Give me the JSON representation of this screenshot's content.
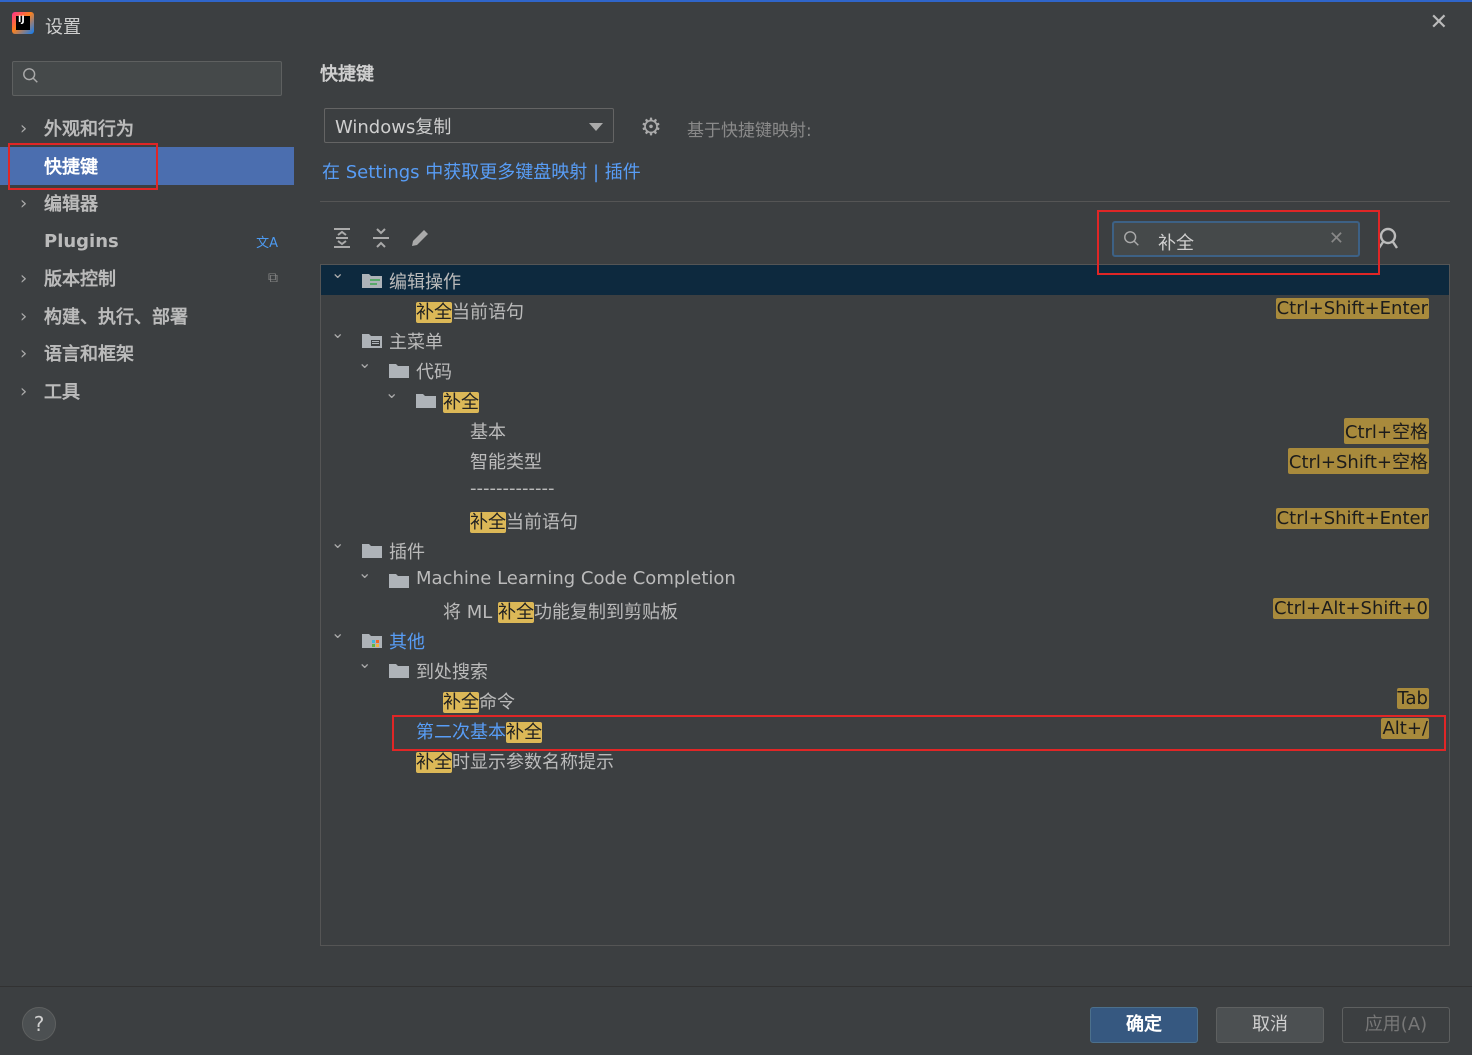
{
  "window": {
    "title": "设置"
  },
  "sidebar": {
    "search_placeholder": "",
    "items": [
      {
        "label": "外观和行为",
        "expandable": true
      },
      {
        "label": "快捷键",
        "expandable": false,
        "selected": true
      },
      {
        "label": "编辑器",
        "expandable": true
      },
      {
        "label": "Plugins",
        "expandable": false,
        "right_icon": "translate-icon"
      },
      {
        "label": "版本控制",
        "expandable": true,
        "right_icon": "copy-icon"
      },
      {
        "label": "构建、执行、部署",
        "expandable": true
      },
      {
        "label": "语言和框架",
        "expandable": true
      },
      {
        "label": "工具",
        "expandable": true
      }
    ]
  },
  "main": {
    "title": "快捷键",
    "keymap_value": "Windows复制",
    "based_on_label": "基于快捷键映射:",
    "settings_link": "在 Settings 中获取更多键盘映射 | 插件",
    "search_value": "补全",
    "tree": [
      {
        "id": "r0",
        "level": 0,
        "expanded": true,
        "icon": "editor-actions-icon",
        "parts": [
          {
            "t": "编辑操作"
          }
        ],
        "selected": true
      },
      {
        "id": "r1",
        "level": 1,
        "parts": [
          {
            "t": "补全",
            "hl": true
          },
          {
            "t": "当前语句"
          }
        ],
        "shortcut": "Ctrl+Shift+Enter"
      },
      {
        "id": "r2",
        "level": 0,
        "expanded": true,
        "icon": "main-menu-icon",
        "parts": [
          {
            "t": "主菜单"
          }
        ]
      },
      {
        "id": "r3",
        "level": 1,
        "expanded": true,
        "icon": "folder-icon",
        "parts": [
          {
            "t": "代码"
          }
        ]
      },
      {
        "id": "r4",
        "level": 2,
        "expanded": true,
        "icon": "folder-icon",
        "parts": [
          {
            "t": "补全",
            "hl": true
          }
        ]
      },
      {
        "id": "r5",
        "level": 3,
        "parts": [
          {
            "t": "基本"
          }
        ],
        "shortcut": "Ctrl+空格"
      },
      {
        "id": "r6",
        "level": 3,
        "parts": [
          {
            "t": "智能类型"
          }
        ],
        "shortcut": "Ctrl+Shift+空格"
      },
      {
        "id": "r7",
        "level": 3,
        "parts": [
          {
            "t": "-------------"
          }
        ]
      },
      {
        "id": "r8",
        "level": 3,
        "parts": [
          {
            "t": "补全",
            "hl": true
          },
          {
            "t": "当前语句"
          }
        ],
        "shortcut": "Ctrl+Shift+Enter"
      },
      {
        "id": "r9",
        "level": 0,
        "expanded": true,
        "icon": "folder-icon",
        "parts": [
          {
            "t": "插件"
          }
        ]
      },
      {
        "id": "r10",
        "level": 1,
        "expanded": true,
        "icon": "folder-icon",
        "parts": [
          {
            "t": "Machine Learning Code Completion"
          }
        ]
      },
      {
        "id": "r11",
        "level": 2,
        "parts": [
          {
            "t": "将 ML "
          },
          {
            "t": "补全",
            "hl": true
          },
          {
            "t": "功能复制到剪贴板"
          }
        ],
        "shortcut": "Ctrl+Alt+Shift+0"
      },
      {
        "id": "r12",
        "level": 0,
        "expanded": true,
        "icon": "other-icon",
        "parts": [
          {
            "t": "其他",
            "blue": true
          }
        ]
      },
      {
        "id": "r13",
        "level": 1,
        "expanded": true,
        "icon": "folder-icon",
        "parts": [
          {
            "t": "到处搜索"
          }
        ]
      },
      {
        "id": "r14",
        "level": 2,
        "parts": [
          {
            "t": "补全",
            "hl": true
          },
          {
            "t": "命令"
          }
        ],
        "shortcut": "Tab"
      },
      {
        "id": "r15",
        "level": 1,
        "parts": [
          {
            "t": "第二次基本",
            "blue": true
          },
          {
            "t": "补全",
            "hl": true
          }
        ],
        "shortcut": "Alt+/"
      },
      {
        "id": "r16",
        "level": 1,
        "parts": [
          {
            "t": "补全",
            "hl": true
          },
          {
            "t": "时显示参数名称提示"
          }
        ]
      }
    ]
  },
  "footer": {
    "help_label": "?",
    "ok_label": "确定",
    "cancel_label": "取消",
    "apply_label": "应用(A)"
  },
  "colors": {
    "accent": "#4b6eaf",
    "highlight": "#dcb857",
    "annotation": "#e02626",
    "link": "#589df6"
  }
}
